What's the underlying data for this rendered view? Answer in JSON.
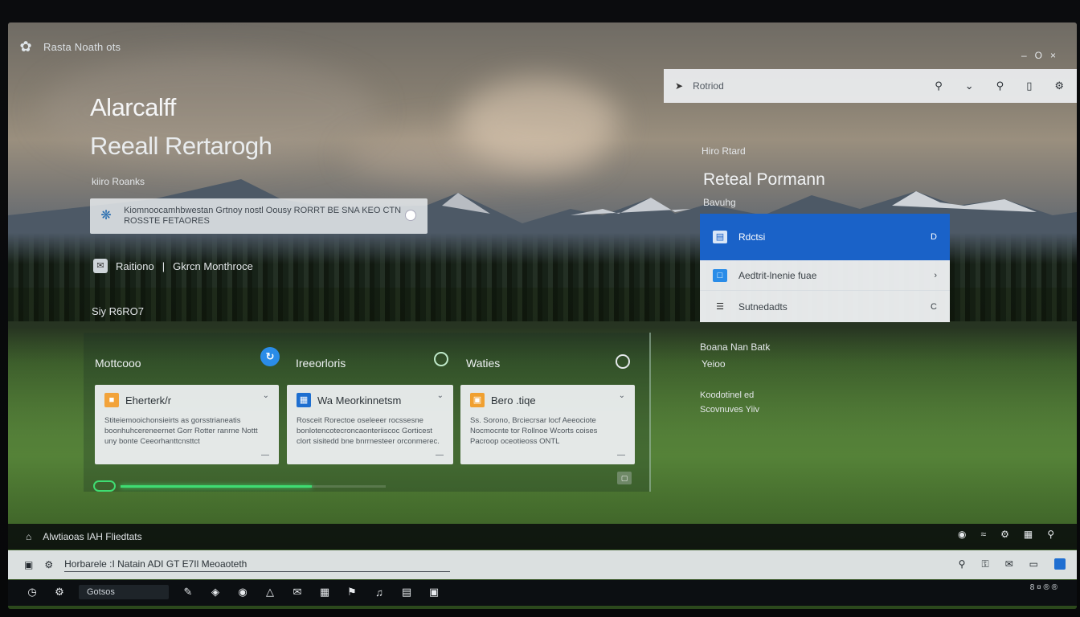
{
  "window": {
    "title": "Rasta Noath ots",
    "controls": [
      "–",
      "O",
      "×"
    ]
  },
  "hero": {
    "title": "Alarcalff",
    "subtitle": "Reeall Rertarogh",
    "label": "kiiro Roanks",
    "notice_text": "Kiomnoocamhbwestan Grtnoy nostl Oousy RORRT BE SNA KEO CTN ROSSTE FETAORES",
    "reply_left": "Raitiono",
    "reply_right": "Gkrcn Monthroce",
    "section_label": "Siy R6RO7"
  },
  "columns": [
    {
      "header": "Mottcooo",
      "card_title": "Eherterk/r",
      "card_body": "Stiteiemooichonsieirts as gorsstrianeatis boonhuhcereneernet Gorr Rotter ranrne Nottt uny bonte Ceeorhanttcnsttct",
      "card_icon": "document-icon",
      "card_color": "#f2a33a"
    },
    {
      "header": "Ireeorloris",
      "card_title": "Wa Meorkinnetsm",
      "card_body": "Rosceit Rorectoe oseleeer rocssesne bonlotencotecroncaonteriiscoc Gorticest clort sisitedd bne bnrrnesteer orconmerec.",
      "card_icon": "image-icon",
      "card_color": "#1e6fd0"
    },
    {
      "header": "Waties",
      "card_title": "Bero .tiqe",
      "card_body": "Ss. Sorono, Brciecrsar locf Aeeociote Nocmocnte tor Rollnoe Wcorts coises Pacroop oceotieoss ONTL",
      "card_icon": "note-icon",
      "card_color": "#f0a030"
    }
  ],
  "progress": {
    "value": 0.72
  },
  "search": {
    "value": "Rotriod",
    "prefix_icon": "cursor-icon",
    "icons": [
      "search-icon",
      "chevron-down-icon",
      "search-alt-icon",
      "bookmark-icon",
      "settings-icon"
    ]
  },
  "right_panel": {
    "label_top": "Hiro Rtard",
    "title": "Reteal Pormann",
    "subtitle": "Bavuhg",
    "menu": [
      {
        "label": "Rdctsi",
        "icon": "folder-icon",
        "end": "D",
        "active": true
      },
      {
        "label": "Aedtrit-lnenie fuae",
        "icon": "chat-icon",
        "end": "›",
        "active": false
      },
      {
        "label": "Sutnedadts",
        "icon": "list-icon",
        "end": "C",
        "active": false
      }
    ],
    "info1": "Boana Nan Batk",
    "info2": "Yeioo",
    "info3": "Koodotinel ed",
    "info4": "Scovnuves Yiiv"
  },
  "status": {
    "left_text": "Alwtiaoas IAH Fliedtats",
    "right_icons": [
      "lock-icon",
      "wifi-icon",
      "gear-icon",
      "grid-icon",
      "bell-icon"
    ]
  },
  "command": {
    "text": "Horbarele :I Natain ADI GT E7Il Meoaoteth",
    "right_icons": [
      "search-icon",
      "key-icon",
      "mail-icon",
      "screen-icon",
      "window-icon"
    ]
  },
  "taskbar": {
    "search_label": "Gotsos",
    "tray_text": "8 ¤ ® ®"
  }
}
